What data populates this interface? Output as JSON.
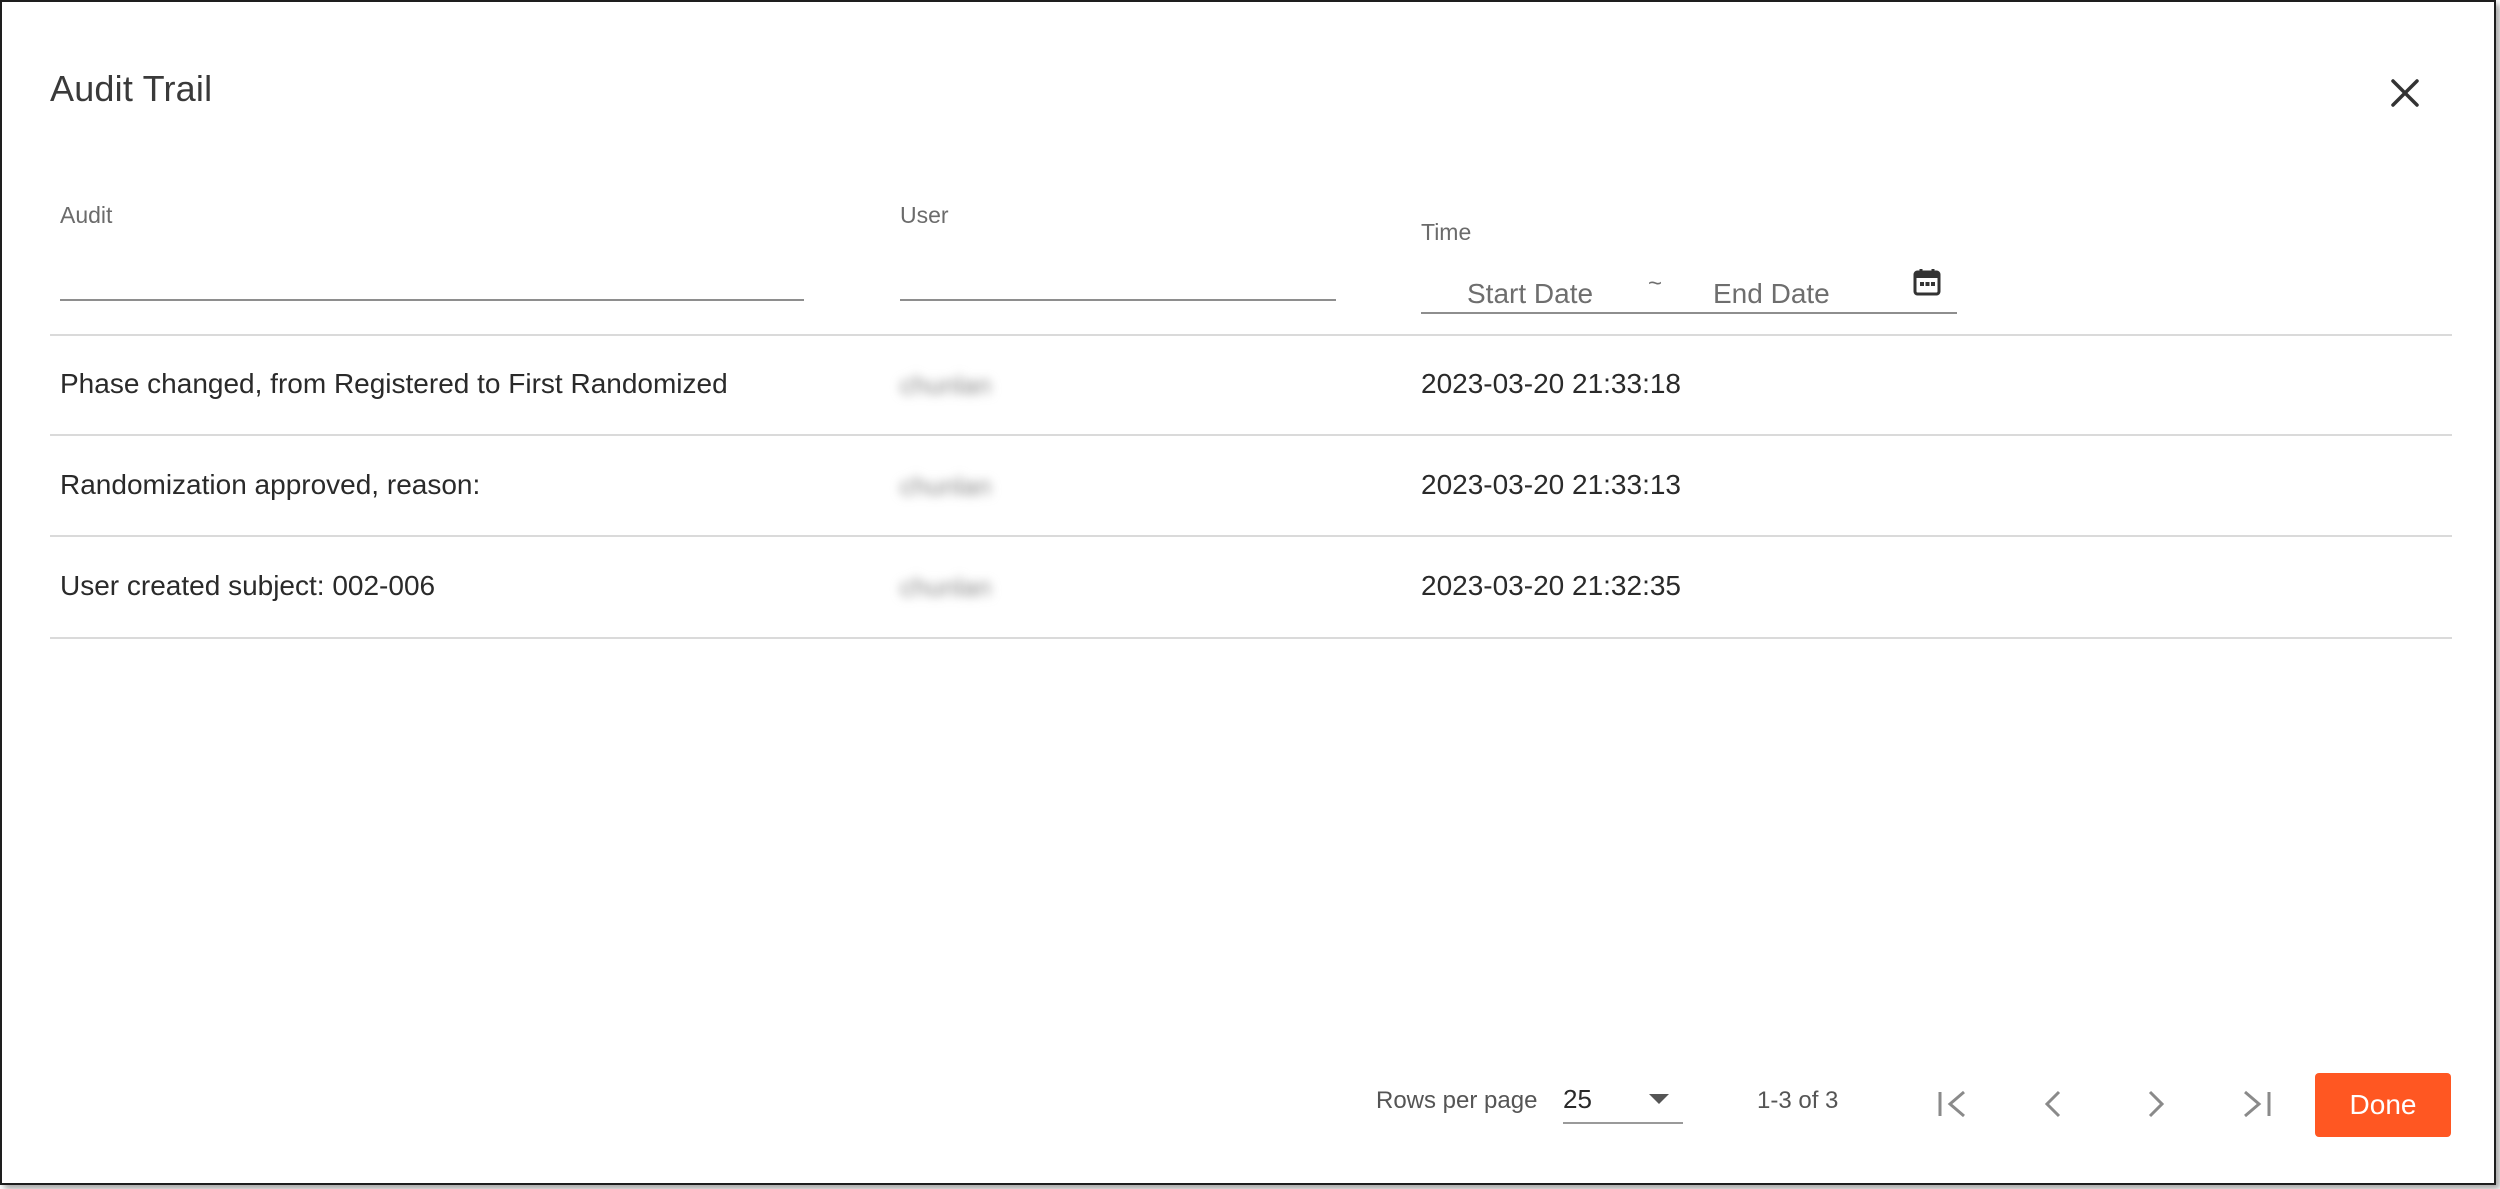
{
  "dialog": {
    "title": "Audit Trail",
    "close_icon": "close-icon"
  },
  "filters": {
    "audit": {
      "label": "Audit",
      "value": ""
    },
    "user": {
      "label": "User",
      "value": ""
    },
    "time": {
      "label": "Time",
      "start_placeholder": "Start Date",
      "separator": "~",
      "end_placeholder": "End Date",
      "calendar_icon": "calendar-icon"
    }
  },
  "rows": [
    {
      "audit": "Phase changed, from Registered to First Randomized",
      "user": "chunlan",
      "time": "2023-03-20 21:33:18"
    },
    {
      "audit": "Randomization approved, reason:",
      "user": "chunlan",
      "time": "2023-03-20 21:33:13"
    },
    {
      "audit": "User created subject: 002-006",
      "user": "chunlan",
      "time": "2023-03-20 21:32:35"
    }
  ],
  "footer": {
    "rows_per_page_label": "Rows per page",
    "rows_per_page_value": "25",
    "range_text": "1-3 of 3",
    "done_label": "Done",
    "first_page_icon": "first-page-icon",
    "prev_page_icon": "chevron-left-icon",
    "next_page_icon": "chevron-right-icon",
    "last_page_icon": "last-page-icon"
  },
  "colors": {
    "accent": "#ff5722",
    "border": "#1e1e1e",
    "divider": "#dadada"
  }
}
